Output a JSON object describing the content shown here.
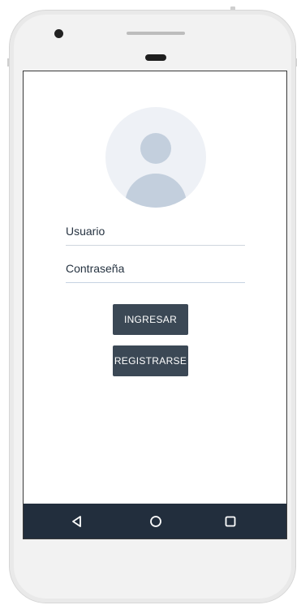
{
  "login": {
    "username_placeholder": "Usuario",
    "password_placeholder": "Contraseña",
    "login_label": "INGRESAR",
    "register_label": "REGISTRARSE"
  },
  "icons": {
    "avatar": "user-avatar-icon",
    "nav_back": "back-triangle-icon",
    "nav_home": "home-circle-icon",
    "nav_recent": "recents-square-icon"
  },
  "colors": {
    "button_bg": "#3b4855",
    "navbar_bg": "#222e3d",
    "avatar_bg": "#eef1f6",
    "avatar_fg": "#c3cfdd"
  }
}
